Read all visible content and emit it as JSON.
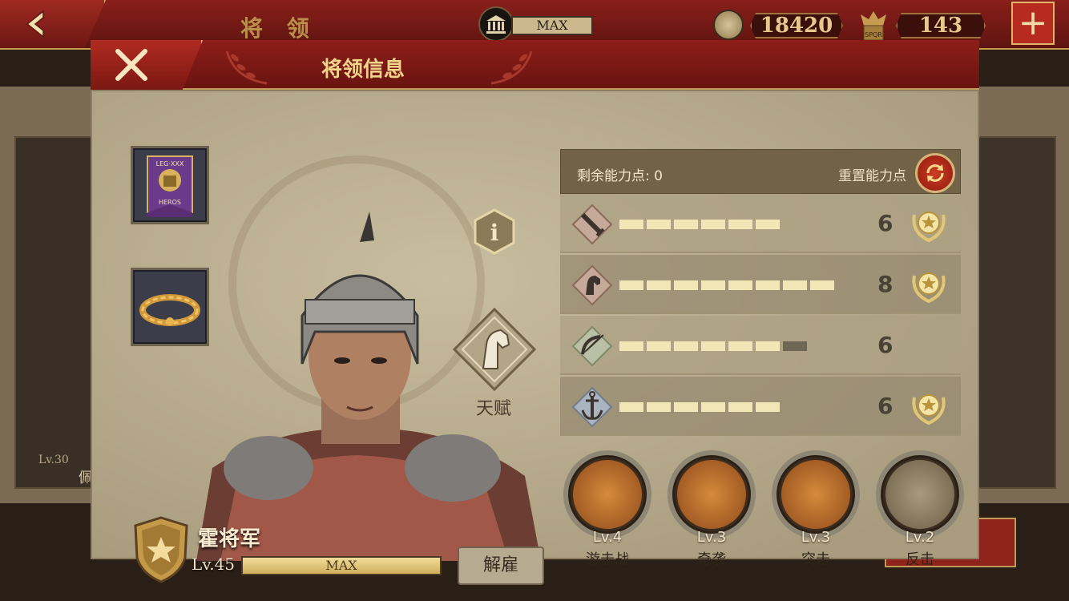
{
  "top_bar": {
    "screen_title": "将 领",
    "building_level": "MAX",
    "coins": "18420",
    "honor": "143"
  },
  "background": {
    "card_level": "Lv.30",
    "card_name": "佩"
  },
  "dialog": {
    "title": "将领信息",
    "talent_label": "天赋",
    "general": {
      "name": "霍将军",
      "level": "Lv.45",
      "exp_text": "MAX",
      "exp_fraction": 1.0,
      "fire_label": "解雇"
    },
    "points": {
      "remaining_label": "剩余能力点: 0",
      "reset_label": "重置能力点"
    },
    "stats": [
      {
        "icon": "sword-icon",
        "value": "6",
        "filled": 6,
        "capacity": 6,
        "badge": true
      },
      {
        "icon": "horse-icon",
        "value": "8",
        "filled": 8,
        "capacity": 8,
        "badge": true
      },
      {
        "icon": "bow-icon",
        "value": "6",
        "filled": 6,
        "capacity": 7,
        "badge": false
      },
      {
        "icon": "anchor-icon",
        "value": "6",
        "filled": 6,
        "capacity": 6,
        "badge": true
      }
    ],
    "skills": [
      {
        "level": "Lv.4",
        "name": "游击战",
        "icon": "guerrilla-skill-icon",
        "active": true
      },
      {
        "level": "Lv.3",
        "name": "奇袭",
        "icon": "raid-skill-icon",
        "active": true
      },
      {
        "level": "Lv.3",
        "name": "突击",
        "icon": "charge-skill-icon",
        "active": true
      },
      {
        "level": "Lv.2",
        "name": "反击",
        "icon": "counter-skill-icon",
        "active": false
      }
    ]
  }
}
